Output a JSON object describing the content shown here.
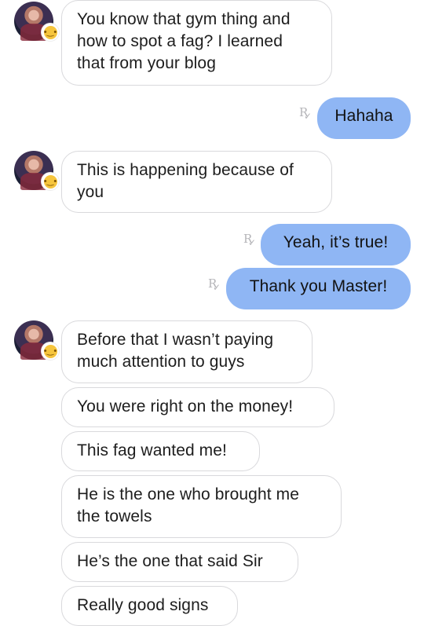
{
  "messages": {
    "m1": "You know that gym thing and\nhow to spot a fag? I learned\nthat from your blog",
    "m2": "Hahaha",
    "m3": "This is happening because of\nyou",
    "m4": "Yeah, it’s true!",
    "m5": "Thank you Master!",
    "m6": "Before that I wasn’t paying\nmuch attention to guys",
    "m7": "You were right on the money!",
    "m8": "This fag wanted me!",
    "m9": "He is the one who brought me\nthe towels",
    "m10": "He’s the one that said Sir",
    "m11": "Really good signs"
  },
  "read_receipt": "R",
  "colors": {
    "outgoing_bubble": "#8fb6f4",
    "incoming_border": "#d9d9dc",
    "receipt": "#b5b5b9"
  },
  "icons": {
    "avatar": "avatar",
    "status_badge": "smiley-face-icon",
    "receipt": "read-receipt-icon"
  }
}
